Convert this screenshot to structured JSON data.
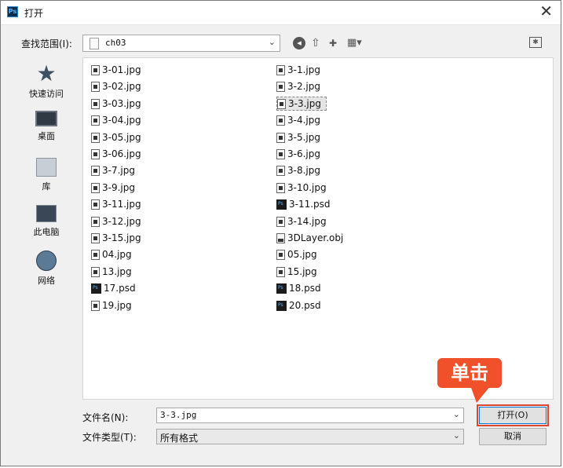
{
  "window": {
    "title": "打开",
    "app_icon": "Ps",
    "close_glyph": "✕"
  },
  "toolbar": {
    "look_in_label": "查找范围(I):",
    "look_in_value": "ch03",
    "chevron": "⌄",
    "icons": [
      "back-icon",
      "up-folder-icon",
      "new-folder-icon",
      "view-menu-icon",
      "action-icon"
    ]
  },
  "places": [
    {
      "label": "快速访问",
      "icon": "quick-access-icon"
    },
    {
      "label": "桌面",
      "icon": "desktop-icon"
    },
    {
      "label": "库",
      "icon": "library-icon"
    },
    {
      "label": "此电脑",
      "icon": "this-pc-icon"
    },
    {
      "label": "网络",
      "icon": "network-icon"
    }
  ],
  "files": {
    "column1": [
      {
        "name": "3-01.jpg",
        "type": "img"
      },
      {
        "name": "3-02.jpg",
        "type": "img"
      },
      {
        "name": "3-03.jpg",
        "type": "img"
      },
      {
        "name": "3-04.jpg",
        "type": "img"
      },
      {
        "name": "3-05.jpg",
        "type": "img"
      },
      {
        "name": "3-06.jpg",
        "type": "img"
      },
      {
        "name": "3-7.jpg",
        "type": "img"
      },
      {
        "name": "3-9.jpg",
        "type": "img"
      },
      {
        "name": "3-11.jpg",
        "type": "img"
      },
      {
        "name": "3-12.jpg",
        "type": "img"
      },
      {
        "name": "3-15.jpg",
        "type": "img"
      },
      {
        "name": "04.jpg",
        "type": "img"
      },
      {
        "name": "13.jpg",
        "type": "img"
      },
      {
        "name": "17.psd",
        "type": "psd"
      },
      {
        "name": "19.jpg",
        "type": "img"
      }
    ],
    "column2": [
      {
        "name": "3-1.jpg",
        "type": "img"
      },
      {
        "name": "3-2.jpg",
        "type": "img"
      },
      {
        "name": "3-3.jpg",
        "type": "img",
        "selected": true
      },
      {
        "name": "3-4.jpg",
        "type": "img"
      },
      {
        "name": "3-5.jpg",
        "type": "img"
      },
      {
        "name": "3-6.jpg",
        "type": "img"
      },
      {
        "name": "3-8.jpg",
        "type": "img"
      },
      {
        "name": "3-10.jpg",
        "type": "img"
      },
      {
        "name": "3-11.psd",
        "type": "psd"
      },
      {
        "name": "3-14.jpg",
        "type": "img"
      },
      {
        "name": "3DLayer.obj",
        "type": "obj"
      },
      {
        "name": "05.jpg",
        "type": "img"
      },
      {
        "name": "15.jpg",
        "type": "img"
      },
      {
        "name": "18.psd",
        "type": "psd"
      },
      {
        "name": "20.psd",
        "type": "psd"
      }
    ]
  },
  "footer": {
    "filename_label": "文件名(N):",
    "filename_value": "3-3.jpg",
    "filetype_label": "文件类型(T):",
    "filetype_value": "所有格式",
    "open_label": "打开(O)",
    "cancel_label": "取消"
  },
  "annotation": {
    "callout_text": "单击",
    "callout_color": "#f0512b"
  }
}
